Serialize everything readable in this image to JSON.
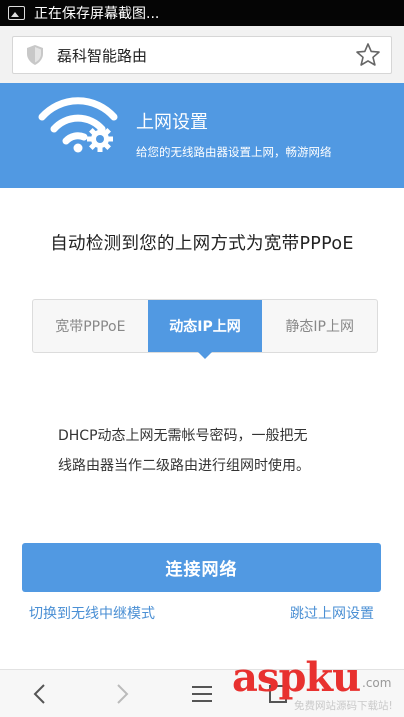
{
  "status_bar": {
    "text": "正在保存屏幕截图..."
  },
  "browser": {
    "site_title": "磊科智能路由"
  },
  "header": {
    "title": "上网设置",
    "subtitle": "给您的无线路由器设置上网，畅游网络",
    "accent": "#5199e2"
  },
  "detect_text": "自动检测到您的上网方式为宽带PPPoE",
  "tabs": [
    {
      "label": "宽带PPPoE",
      "active": false
    },
    {
      "label": "动态IP上网",
      "active": true
    },
    {
      "label": "静态IP上网",
      "active": false
    }
  ],
  "description": {
    "line1": "DHCP动态上网无需帐号密码，一般把无",
    "line2": "线路由器当作二级路由进行组网时使用。"
  },
  "connect_button": "连接网络",
  "links": {
    "switch_mode": "切换到无线中继模式",
    "skip": "跳过上网设置"
  },
  "watermark": {
    "brand_asp": "asp",
    "brand_ku": "ku",
    "com": ".com",
    "tagline": "免费网站源码下载站!"
  }
}
